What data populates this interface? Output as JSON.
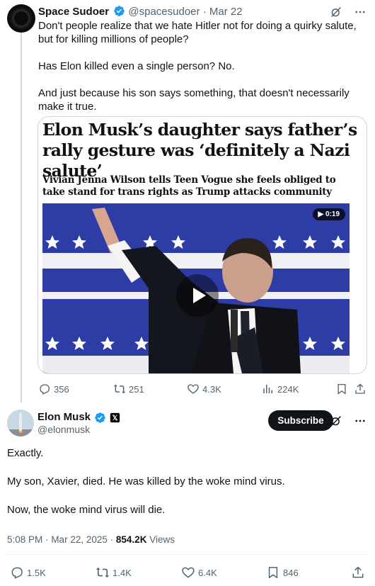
{
  "parent_tweet": {
    "name": "Space Sudoer",
    "handle": "@spacesudoer",
    "separator": "·",
    "date": "Mar 22",
    "text": [
      "Don't people realize that we hate Hitler not for doing a quirky salute, but for killing millions of people?",
      "Has Elon killed even a single person? No.",
      "And just because his son says something, that doesn't necessarily make it true."
    ],
    "card": {
      "headline": "Elon Musk’s daughter says father’s rally gesture was ‘definitely a Nazi salute’",
      "subheadline": "Vivian Jenna Wilson tells Teen Vogue she feels obliged to take stand for trans rights as Trump attacks community",
      "video_duration": "0:19"
    },
    "stats": {
      "replies": "356",
      "reposts": "251",
      "likes": "4.3K",
      "views": "224K"
    }
  },
  "main_tweet": {
    "name": "Elon Musk",
    "handle": "@elonmusk",
    "affiliate_badge": "𝕏",
    "subscribe_label": "Subscribe",
    "text": [
      "Exactly.",
      "My son, Xavier, died. He was killed by the woke mind virus.",
      "Now, the woke mind virus will die."
    ],
    "time": "5:08 PM",
    "separator": "·",
    "date": "Mar 22, 2025",
    "views_count": "854.2K",
    "views_label": "Views",
    "stats": {
      "replies": "1.5K",
      "reposts": "1.4K",
      "likes": "6.4K",
      "bookmarks": "846"
    }
  },
  "colors": {
    "text_primary": "#0f1419",
    "text_secondary": "#536471",
    "verified_blue": "#1d9bf0",
    "border": "#cfd9de"
  },
  "icons": [
    "grok-icon",
    "more-icon",
    "reply-icon",
    "repost-icon",
    "like-icon",
    "views-icon",
    "bookmark-icon",
    "share-icon",
    "play-icon",
    "verified-badge-icon"
  ]
}
